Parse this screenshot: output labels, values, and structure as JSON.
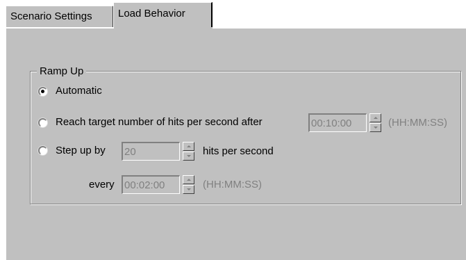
{
  "tabs": [
    {
      "label": "Scenario Settings",
      "active": false
    },
    {
      "label": "Load Behavior",
      "active": true
    }
  ],
  "ramp_up": {
    "group_label": "Ramp Up",
    "selected": "automatic",
    "automatic_label": "Automatic",
    "reach_target_label": "Reach target number of hits per second after",
    "reach_target_value": "00:10:00",
    "reach_target_unit": "(HH:MM:SS)",
    "step_up_label": "Step up by",
    "step_up_value": "20",
    "step_up_unit": "hits per second",
    "every_label": "every",
    "every_value": "00:02:00",
    "every_unit": "(HH:MM:SS)"
  },
  "icons": {
    "spin_up": "spin-up-arrow",
    "spin_down": "spin-down-arrow",
    "radio": "radio-button"
  }
}
